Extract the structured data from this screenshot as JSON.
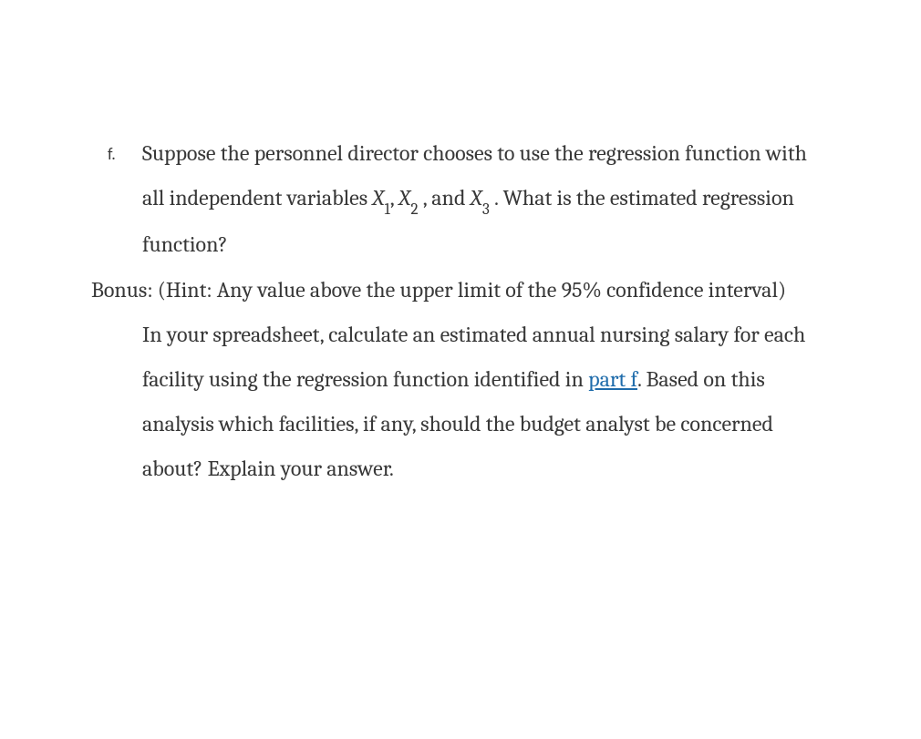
{
  "question_f": {
    "marker": "f.",
    "text_before_vars": "Suppose the personnel director chooses to use the regression function with all independent variables ",
    "x1": "X",
    "x1_sub": "1",
    "sep1": ", ",
    "x2": "X",
    "x2_sub": "2",
    "sep2": " , and ",
    "x3": "X",
    "x3_sub": "3",
    "text_after_vars": " . What is the estimated regression function?"
  },
  "bonus": {
    "label": "Bonus: (Hint: Any value above the upper limit of the 95% confidence interval)",
    "instr_before_link": "In your spreadsheet, calculate an estimated annual nursing salary for each facility using the regression function identified in ",
    "link_text": "part f",
    "instr_after_link": ". Based on this analysis which facilities, if any, should the budget analyst be concerned about? Explain your answer."
  }
}
